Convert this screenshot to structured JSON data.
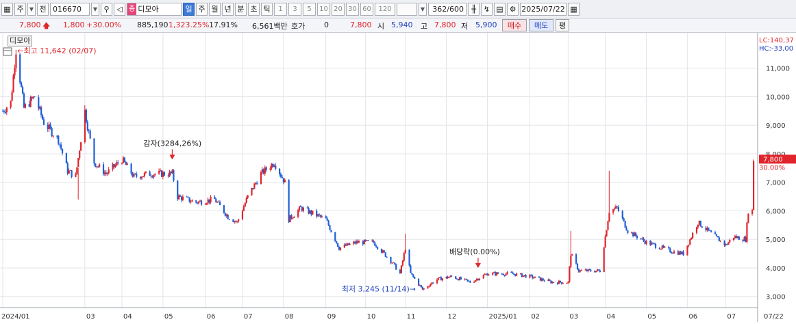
{
  "toolbar": {
    "market": "주",
    "prev_label": "전",
    "code": "016670",
    "tag": "종",
    "name": "디모아",
    "periods": [
      "일",
      "주",
      "월",
      "년",
      "분",
      "초",
      "틱"
    ],
    "active_period": "일",
    "minute_options": [
      "1",
      "3",
      "5",
      "10",
      "20",
      "30",
      "60",
      "120"
    ],
    "count": "362/600",
    "date": "2025/07/22"
  },
  "quote": {
    "price": "7,800",
    "change": "1,800",
    "change_pct": "+30.00%",
    "volume": "885,190",
    "volume_ratio": "1,323.25%",
    "turnover": "17.91%",
    "amount": "6,561백만",
    "hoga_label": "호가",
    "hoga_value": "0",
    "hoga_price": "7,800",
    "open_label": "시",
    "open": "5,940",
    "high_label": "고",
    "high": "7,800",
    "low_label": "저",
    "low": "5,900",
    "buy_label": "매수",
    "sell_label": "매도",
    "avg_label": "평"
  },
  "chart_legend": "디모아",
  "colors": {
    "up": "#e0242b",
    "down": "#1f5fd6",
    "grid": "#e3e5ea",
    "axis": "#333333"
  },
  "chart_data": {
    "type": "candlestick",
    "y_ticks": [
      3000,
      4000,
      5000,
      6000,
      7000,
      8000,
      9000,
      10000,
      11000
    ],
    "y_tick_labels": [
      "3,000",
      "4,000",
      "5,000",
      "6,000",
      "7,000",
      "8,000",
      "9,000",
      "10,000",
      "11,000"
    ],
    "ylim": [
      2850,
      12000
    ],
    "x_labels": [
      "2024/01",
      "03",
      "04",
      "05",
      "06",
      "07",
      "08",
      "09",
      "10",
      "11",
      "12",
      "2025/01",
      "02",
      "03",
      "04",
      "05",
      "06",
      "07",
      "07/22"
    ],
    "x_label_dates": [
      "2024-01-02",
      "2024-03-04",
      "2024-04-01",
      "2024-05-02",
      "2024-06-03",
      "2024-07-01",
      "2024-08-01",
      "2024-09-02",
      "2024-10-02",
      "2024-11-01",
      "2024-12-02",
      "2025-01-02",
      "2025-02-03",
      "2025-03-04",
      "2025-04-01",
      "2025-05-02",
      "2025-06-02",
      "2025-07-01",
      "2025-07-22"
    ],
    "price_path": [
      [
        "2024-01-02",
        9500
      ],
      [
        "2024-01-08",
        9800
      ],
      [
        "2024-01-12",
        11642
      ],
      [
        "2024-01-18",
        9600
      ],
      [
        "2024-01-26",
        10000
      ],
      [
        "2024-02-02",
        9100
      ],
      [
        "2024-02-13",
        8500
      ],
      [
        "2024-02-20",
        7400
      ],
      [
        "2024-02-26",
        7200
      ],
      [
        "2024-03-04",
        9500
      ],
      [
        "2024-03-11",
        7700
      ],
      [
        "2024-03-20",
        7300
      ],
      [
        "2024-04-01",
        7800
      ],
      [
        "2024-04-10",
        7200
      ],
      [
        "2024-04-22",
        7300
      ],
      [
        "2024-05-03",
        7300
      ],
      [
        "2024-05-09",
        7300
      ],
      [
        "2024-05-13",
        6500
      ],
      [
        "2024-05-27",
        6300
      ],
      [
        "2024-06-10",
        6400
      ],
      [
        "2024-06-20",
        5800
      ],
      [
        "2024-06-27",
        5600
      ],
      [
        "2024-07-05",
        6500
      ],
      [
        "2024-07-15",
        7300
      ],
      [
        "2024-07-25",
        7700
      ],
      [
        "2024-08-02",
        7000
      ],
      [
        "2024-08-05",
        5700
      ],
      [
        "2024-08-14",
        6100
      ],
      [
        "2024-09-02",
        5700
      ],
      [
        "2024-09-12",
        4700
      ],
      [
        "2024-09-25",
        4900
      ],
      [
        "2024-10-08",
        4900
      ],
      [
        "2024-10-22",
        4200
      ],
      [
        "2024-10-28",
        3800
      ],
      [
        "2024-11-01",
        4700
      ],
      [
        "2024-11-05",
        3800
      ],
      [
        "2024-11-14",
        3245
      ],
      [
        "2024-11-25",
        3600
      ],
      [
        "2024-12-06",
        3700
      ],
      [
        "2024-12-20",
        3500
      ],
      [
        "2025-01-02",
        3800
      ],
      [
        "2025-01-20",
        3800
      ],
      [
        "2025-02-03",
        3700
      ],
      [
        "2025-02-20",
        3500
      ],
      [
        "2025-03-04",
        3500
      ],
      [
        "2025-03-06",
        4500
      ],
      [
        "2025-03-12",
        3900
      ],
      [
        "2025-03-28",
        3900
      ],
      [
        "2025-04-04",
        6000
      ],
      [
        "2025-04-10",
        6100
      ],
      [
        "2025-04-18",
        5300
      ],
      [
        "2025-05-02",
        4900
      ],
      [
        "2025-05-20",
        4600
      ],
      [
        "2025-05-30",
        4500
      ],
      [
        "2025-06-04",
        5000
      ],
      [
        "2025-06-10",
        5600
      ],
      [
        "2025-06-20",
        5200
      ],
      [
        "2025-07-01",
        4800
      ],
      [
        "2025-07-07",
        5100
      ],
      [
        "2025-07-16",
        5000
      ],
      [
        "2025-07-17",
        5500
      ],
      [
        "2025-07-18",
        6000
      ],
      [
        "2025-07-21",
        6000
      ],
      [
        "2025-07-22",
        7800
      ]
    ],
    "spikes": [
      [
        "2024-01-12",
        11642
      ],
      [
        "2024-03-04",
        9700
      ],
      [
        "2024-02-28",
        6400
      ],
      [
        "2024-11-01",
        5200
      ],
      [
        "2025-03-06",
        5300
      ],
      [
        "2025-04-04",
        7400
      ],
      [
        "2025-07-22",
        7800
      ]
    ],
    "annotations": [
      {
        "text": "←최고 11,642 (02/07)",
        "date": "2024-01-12",
        "value": 11642,
        "color": "#e0242b"
      },
      {
        "text": "최저 3,245 (11/14)→",
        "date": "2024-11-14",
        "value": 3245,
        "color": "#1d3fbf"
      },
      {
        "text": "감자(3284,26%)",
        "date": "2024-05-09",
        "value": 7800,
        "color": "#222222"
      },
      {
        "text": "배당락(0.00%)",
        "date": "2024-12-26",
        "value": 4000,
        "color": "#222222"
      }
    ],
    "indicators": [
      "LC:140,37",
      "HC:-33,00"
    ],
    "last_price_label": "7,800",
    "last_pct_label": "30.00%"
  }
}
